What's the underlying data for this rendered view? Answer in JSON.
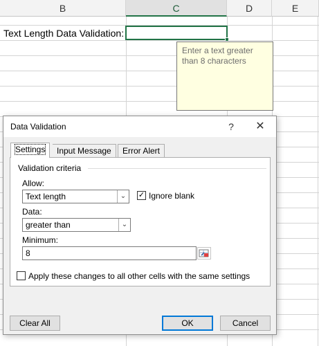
{
  "sheet": {
    "columns": [
      "B",
      "C",
      "D",
      "E"
    ],
    "selected_column": "C",
    "cell_b_text": "Text Length Data Validation:",
    "input_message_tooltip": "Enter a text greater than 8 characters"
  },
  "dialog": {
    "title": "Data Validation",
    "help_glyph": "?",
    "close_glyph": "✕",
    "tabs": [
      {
        "label": "Settings",
        "active": true
      },
      {
        "label": "Input Message",
        "active": false
      },
      {
        "label": "Error Alert",
        "active": false
      }
    ],
    "settings": {
      "group_label": "Validation criteria",
      "allow_label": "Allow:",
      "allow_value": "Text length",
      "ignore_blank_label": "Ignore blank",
      "ignore_blank_checked": true,
      "data_label": "Data:",
      "data_value": "greater than",
      "minimum_label": "Minimum:",
      "minimum_value": "8",
      "apply_all_label": "Apply these changes to all other cells with the same settings",
      "apply_all_checked": false
    },
    "buttons": {
      "clear_all": "Clear All",
      "ok": "OK",
      "cancel": "Cancel"
    }
  },
  "colors": {
    "accent_green": "#217346",
    "tooltip_bg": "#ffffe1",
    "default_button_border": "#0078d7"
  },
  "icons": [
    "chevron-down-icon",
    "checkmark-icon",
    "range-selector-icon",
    "help-icon",
    "close-icon"
  ]
}
